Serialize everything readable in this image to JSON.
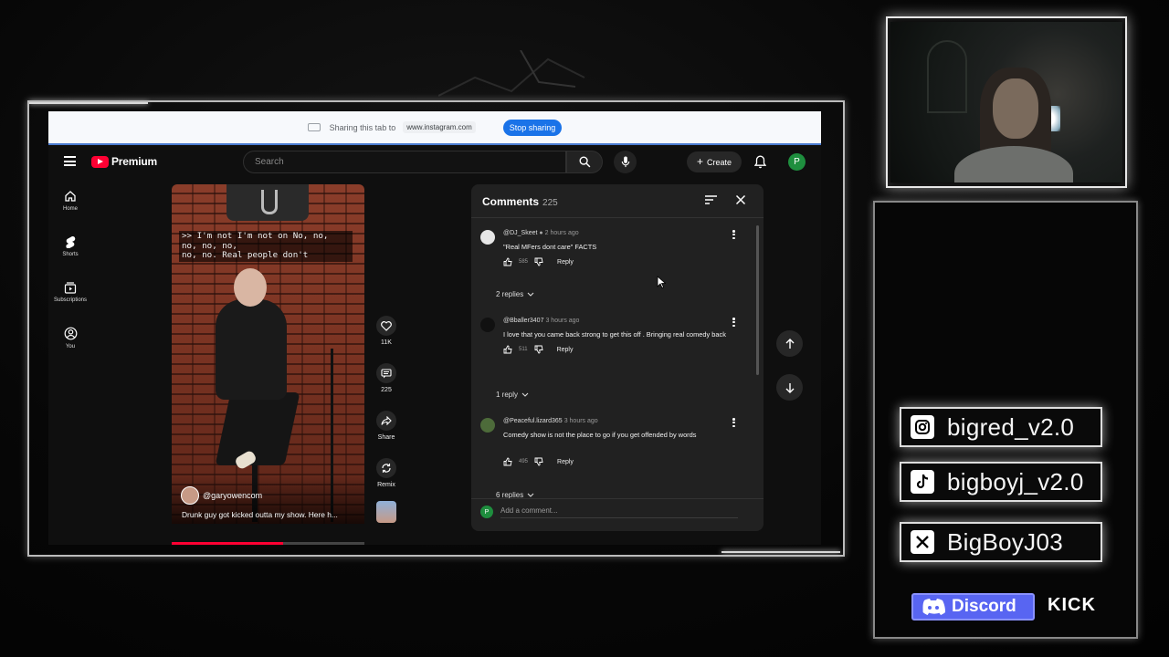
{
  "share_bar": {
    "text": "Sharing this tab to",
    "url": "www.instagram.com",
    "stop_label": "Stop sharing"
  },
  "header": {
    "logo_text": "Premium",
    "search_placeholder": "Search",
    "create_label": "Create",
    "avatar_letter": "P"
  },
  "sidebar": {
    "items": [
      {
        "label": "Home",
        "icon": "home-icon"
      },
      {
        "label": "Shorts",
        "icon": "shorts-icon"
      },
      {
        "label": "Subscriptions",
        "icon": "subscriptions-icon"
      },
      {
        "label": "You",
        "icon": "you-icon"
      }
    ]
  },
  "video": {
    "caption": ">> I'm not I'm not on No, no,\nno, no, no,\nno, no. Real people don't",
    "channel": "@garyowencom",
    "title": "Drunk guy got kicked outta my show. Here h...",
    "progress": 0.58
  },
  "actions": {
    "likes": "11K",
    "comments": "225",
    "share": "Share",
    "remix": "Remix"
  },
  "comments_panel": {
    "title": "Comments",
    "count": "225",
    "items": [
      {
        "author": "@DJ_Skeet",
        "verified": true,
        "time": "2 hours ago",
        "text": "\"Real MFers dont care\" FACTS",
        "likes": "585",
        "reply_label": "Reply",
        "replies_label": "2 replies"
      },
      {
        "author": "@Bballer3407",
        "time": "3 hours ago",
        "text": "I love that you came back strong to get this off . Bringing real comedy back",
        "likes": "511",
        "reply_label": "Reply",
        "replies_label": "1 reply"
      },
      {
        "author": "@Peaceful.lizard365",
        "time": "3 hours ago",
        "text": "Comedy show is not the place to go if you get offended by words",
        "likes": "495",
        "reply_label": "Reply",
        "replies_label": "6 replies"
      }
    ],
    "add_placeholder": "Add a comment...",
    "add_avatar_letter": "P"
  },
  "socials": {
    "instagram": "bigred_v2.0",
    "tiktok": "bigboyj_v2.0",
    "x": "BigBoyJ03",
    "discord": "Discord",
    "kick": "KICK"
  },
  "colors": {
    "youtube_red": "#ff0033",
    "stop_sharing_blue": "#1a73e8",
    "discord": "#5865f2",
    "avatar_green": "#1e8e3e"
  }
}
